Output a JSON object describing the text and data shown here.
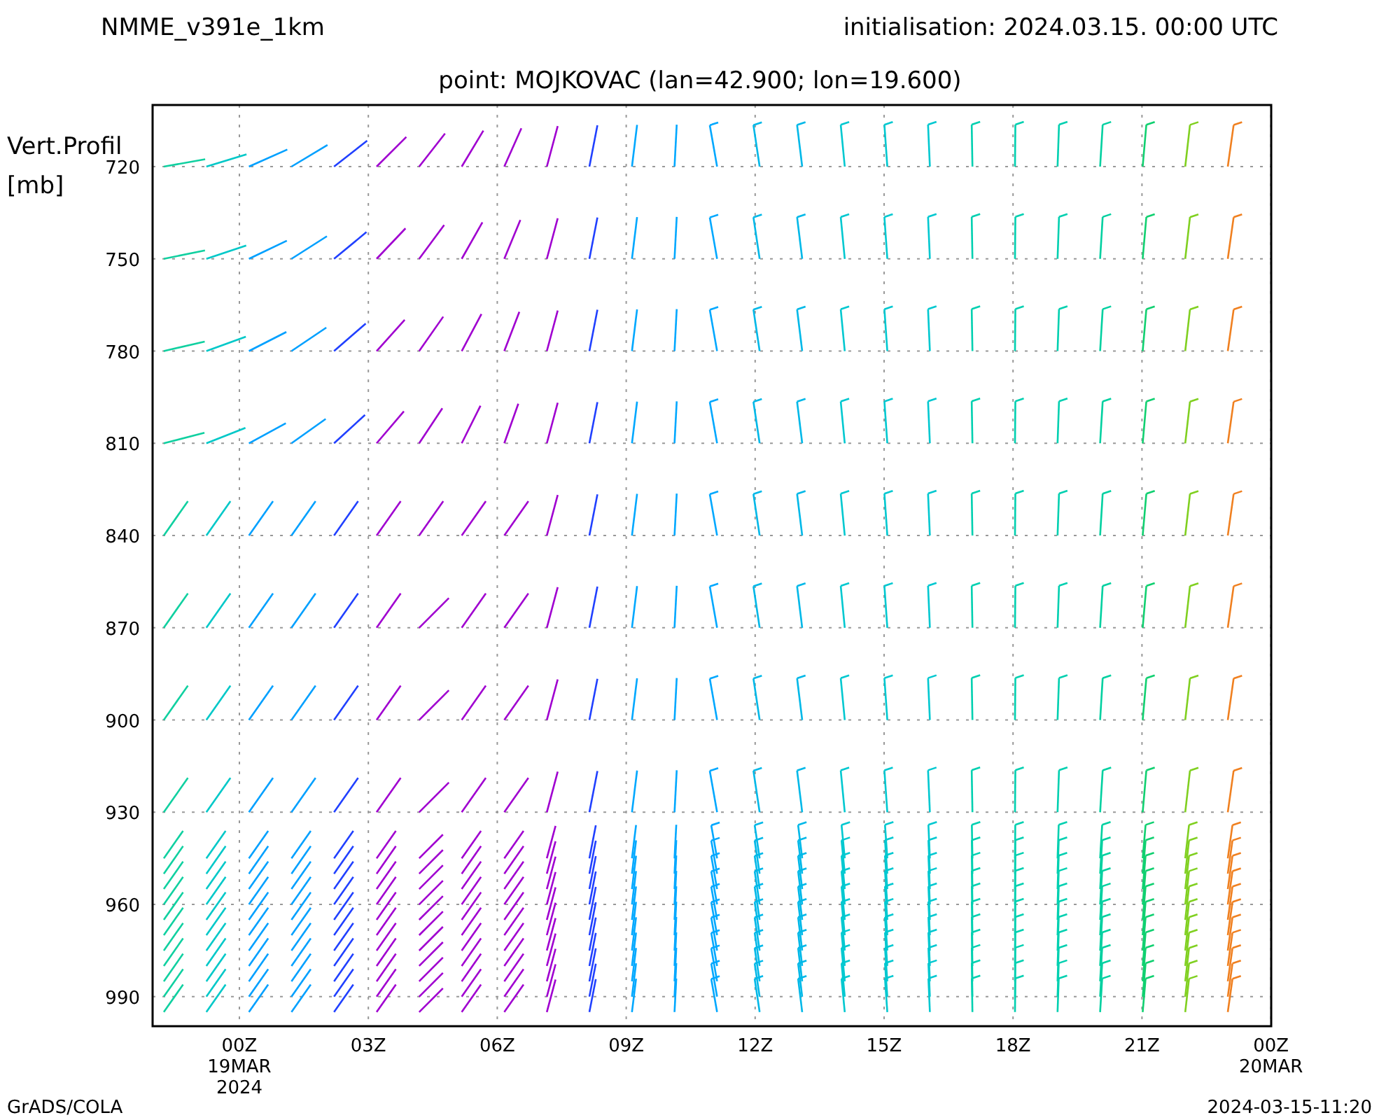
{
  "model": "NMME_v391e_1km",
  "initialisation": "initialisation: 2024.03.15. 00:00 UTC",
  "point": "point: MOJKOVAC (lan=42.900; lon=19.600)",
  "y_axis_label": [
    "Vert.Profil",
    "[mb]"
  ],
  "y_ticks": [
    "720",
    "750",
    "780",
    "810",
    "840",
    "870",
    "900",
    "930",
    "960",
    "990"
  ],
  "x_ticks": [
    {
      "label": "00Z",
      "sub": [
        "19MAR",
        "2024"
      ]
    },
    {
      "label": "03Z"
    },
    {
      "label": "06Z"
    },
    {
      "label": "09Z"
    },
    {
      "label": "12Z"
    },
    {
      "label": "15Z"
    },
    {
      "label": "18Z"
    },
    {
      "label": "21Z"
    },
    {
      "label": "00Z",
      "sub": [
        "20MAR"
      ]
    }
  ],
  "footer_left": "GrADS/COLA",
  "footer_right": "2024-03-15-11:20"
}
